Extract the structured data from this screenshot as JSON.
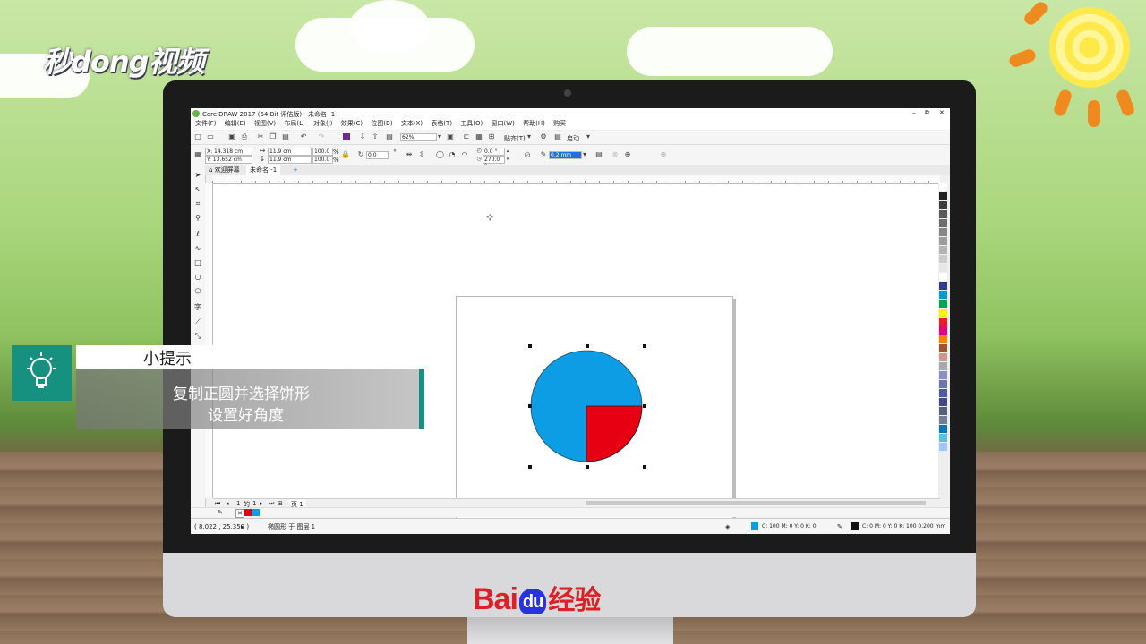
{
  "brand": {
    "corner_logo": "秒dong视频",
    "bottom_logo_bai": "Bai",
    "bottom_logo_du": "du",
    "bottom_logo_suffix": "经验"
  },
  "app": {
    "title": "CorelDRAW 2017 (64-Bit 评估版) - 未命名 -1",
    "menu": [
      "文件(F)",
      "编辑(E)",
      "视图(V)",
      "布局(L)",
      "对象(J)",
      "效果(C)",
      "位图(B)",
      "文本(X)",
      "表格(T)",
      "工具(O)",
      "窗口(W)",
      "帮助(H)",
      "购买"
    ],
    "toolbar": {
      "zoom": "62%",
      "snap_label": "贴齐(T)",
      "launch_label": "启动"
    },
    "property_bar": {
      "x": "X: 14.318 cm",
      "y": "Y: 13.652 cm",
      "width": "11.9 cm",
      "height": "11.9 cm",
      "scale_x": "100.0",
      "scale_y": "100.0",
      "pct": "%",
      "rotation": "0.0",
      "start_angle": "0.0 °",
      "end_angle": "270.0 °",
      "outline": "0.2 mm"
    },
    "tabs": {
      "welcome": "欢迎屏幕",
      "document": "未命名 -1"
    },
    "page_nav": {
      "current": "1",
      "of": "的",
      "total": "1",
      "page_tab": "页 1"
    },
    "status": {
      "coords": "( 8.022 , 25.359 )",
      "object_info": "椭圆形 于 图层 1",
      "fill_info": "C: 100 M: 0 Y: 0 K: 0",
      "outline_info": "C: 0 M: 0 Y: 0 K: 100  0.200 mm"
    },
    "colors": {
      "fill_blue": "#0d9de4",
      "slice_red": "#e60012",
      "highlight": "#e8607b"
    },
    "palette": [
      "#ffffff",
      "#231f20",
      "#3d3d3d",
      "#595959",
      "#6e6e6e",
      "#858585",
      "#9c9c9c",
      "#b3b3b3",
      "#cccccc",
      "#e6e6e6",
      "#ffffff",
      "#2b3d8c",
      "#0099d9",
      "#00a651",
      "#fff200",
      "#ed1c24",
      "#e4007f",
      "#ff7f00",
      "#a0522d",
      "#c69c8a",
      "#a7a9ac",
      "#8c8fc6",
      "#6d72b5",
      "#4d5aa6",
      "#3f4a8c",
      "#56627a",
      "#6f7f99",
      "#0077c0",
      "#5bc0de",
      "#a0c4ff"
    ]
  },
  "tip": {
    "title": "小提示",
    "line1": "复制正圆并选择饼形",
    "line2": "设置好角度"
  }
}
